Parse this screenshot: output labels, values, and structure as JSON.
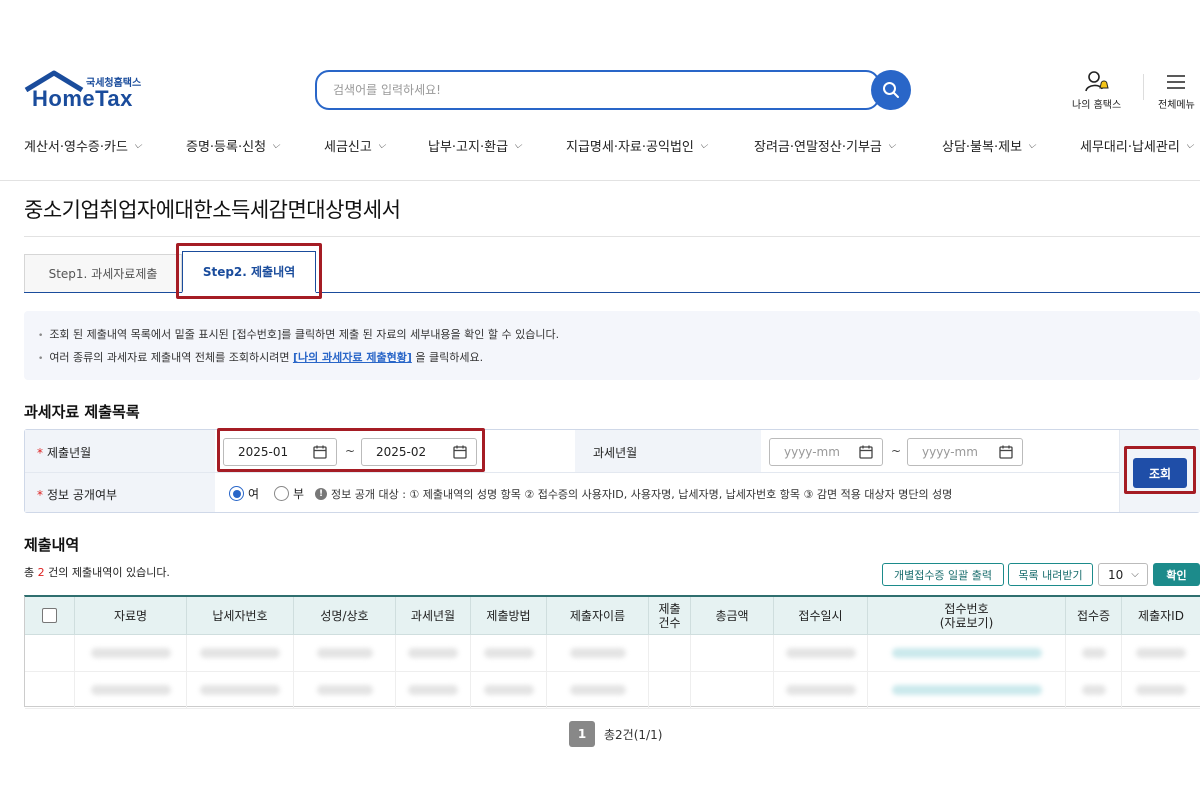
{
  "header": {
    "logo_subtitle": "국세청홈택스",
    "logo_title": "HomeTax",
    "search_placeholder": "검색어를 입력하세요!",
    "my_hometax": "나의 홈택스",
    "all_menu": "전체메뉴"
  },
  "gnb": [
    "계산서·영수증·카드",
    "증명·등록·신청",
    "세금신고",
    "납부·고지·환급",
    "지급명세·자료·공익법인",
    "장려금·연말정산·기부금",
    "상담·불복·제보",
    "세무대리·납세관리"
  ],
  "page_title": "중소기업취업자에대한소득세감면대상명세서",
  "tabs": [
    "Step1. 과세자료제출",
    "Step2. 제출내역"
  ],
  "info": {
    "line1": "조회 된 제출내역 목록에서 밑줄 표시된 [접수번호]를 클릭하면 제출 된 자료의 세부내용을 확인 할 수 있습니다.",
    "line2_pre": "여러 종류의 과세자료 제출내역 전체를 조회하시려면 ",
    "line2_link": "[나의 과세자료 제출현황]",
    "line2_post": " 을 클릭하세요."
  },
  "list_title": "과세자료 제출목록",
  "form": {
    "submit_period_label": "제출년월",
    "submit_from": "2025-01",
    "submit_to": "2025-02",
    "tax_period_label": "과세년월",
    "date_placeholder": "yyyy-mm",
    "disclosure_label": "정보 공개여부",
    "radio_yes": "여",
    "radio_no": "부",
    "disclosure_note": "정보 공개 대상 : ① 제출내역의 성명 항목 ② 접수증의 사용자ID, 사용자명, 납세자명, 납세자번호 항목 ③ 감면 적용 대상자 명단의 성명",
    "search_button": "조회",
    "tilde": "~"
  },
  "results": {
    "title": "제출내역",
    "count_pre": "총 ",
    "count_num": "2",
    "count_post": " 건의 제출내역이 있습니다.",
    "btn_print": "개별접수증 일괄 출력",
    "btn_download": "목록 내려받기",
    "page_size": "10",
    "btn_confirm": "확인",
    "columns": [
      "자료명",
      "납세자번호",
      "성명/상호",
      "과세년월",
      "제출방법",
      "제출자이름",
      "제출\n건수",
      "총금액",
      "접수일시",
      "접수번호\n(자료보기)",
      "접수증",
      "제출자ID"
    ],
    "rows": 2
  },
  "pagination": {
    "current": "1",
    "summary": "총2건(1/1)"
  },
  "colors": {
    "brand_blue": "#1a4c9c",
    "accent_blue": "#2966c8",
    "teal": "#1c8b8b",
    "highlight_red": "#a51c24"
  }
}
